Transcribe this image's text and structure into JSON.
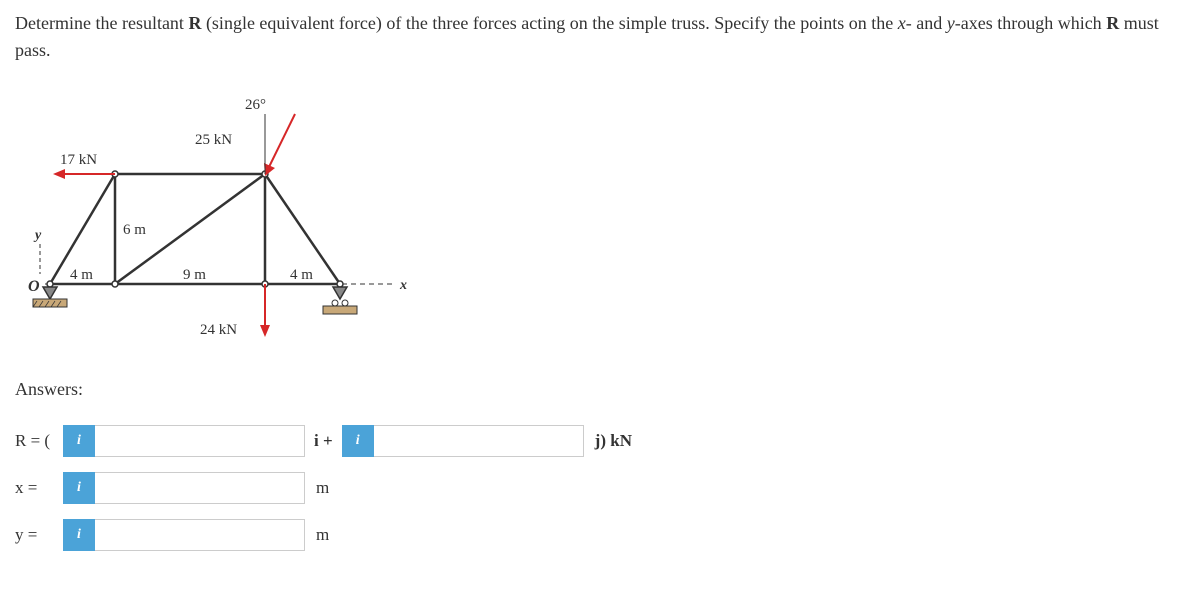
{
  "problem": {
    "text_before_R": "Determine the resultant ",
    "R": "R",
    "text_mid": " (single equivalent force) of the three forces acting on the simple truss. Specify the points on the ",
    "x": "x",
    "dash": "- and ",
    "y": "y",
    "text_mid2": "-axes through which ",
    "R2": "R",
    "text_end": " must pass."
  },
  "diagram": {
    "angle_label": "26°",
    "force_25": "25 kN",
    "force_17": "17 kN",
    "force_24": "24 kN",
    "dim_6m": "6 m",
    "dim_4m_left": "4 m",
    "dim_9m": "9 m",
    "dim_4m_right": "4 m",
    "y_axis": "y",
    "x_axis": "x",
    "origin": "O"
  },
  "answers": {
    "title": "Answers:",
    "R_label": "R = (",
    "i_plus": "i +",
    "j_unit": "j) kN",
    "x_label": "x =",
    "y_label": "y =",
    "m_unit": "m",
    "info_icon": "i",
    "R_i_value": "",
    "R_j_value": "",
    "x_value": "",
    "y_value": ""
  }
}
